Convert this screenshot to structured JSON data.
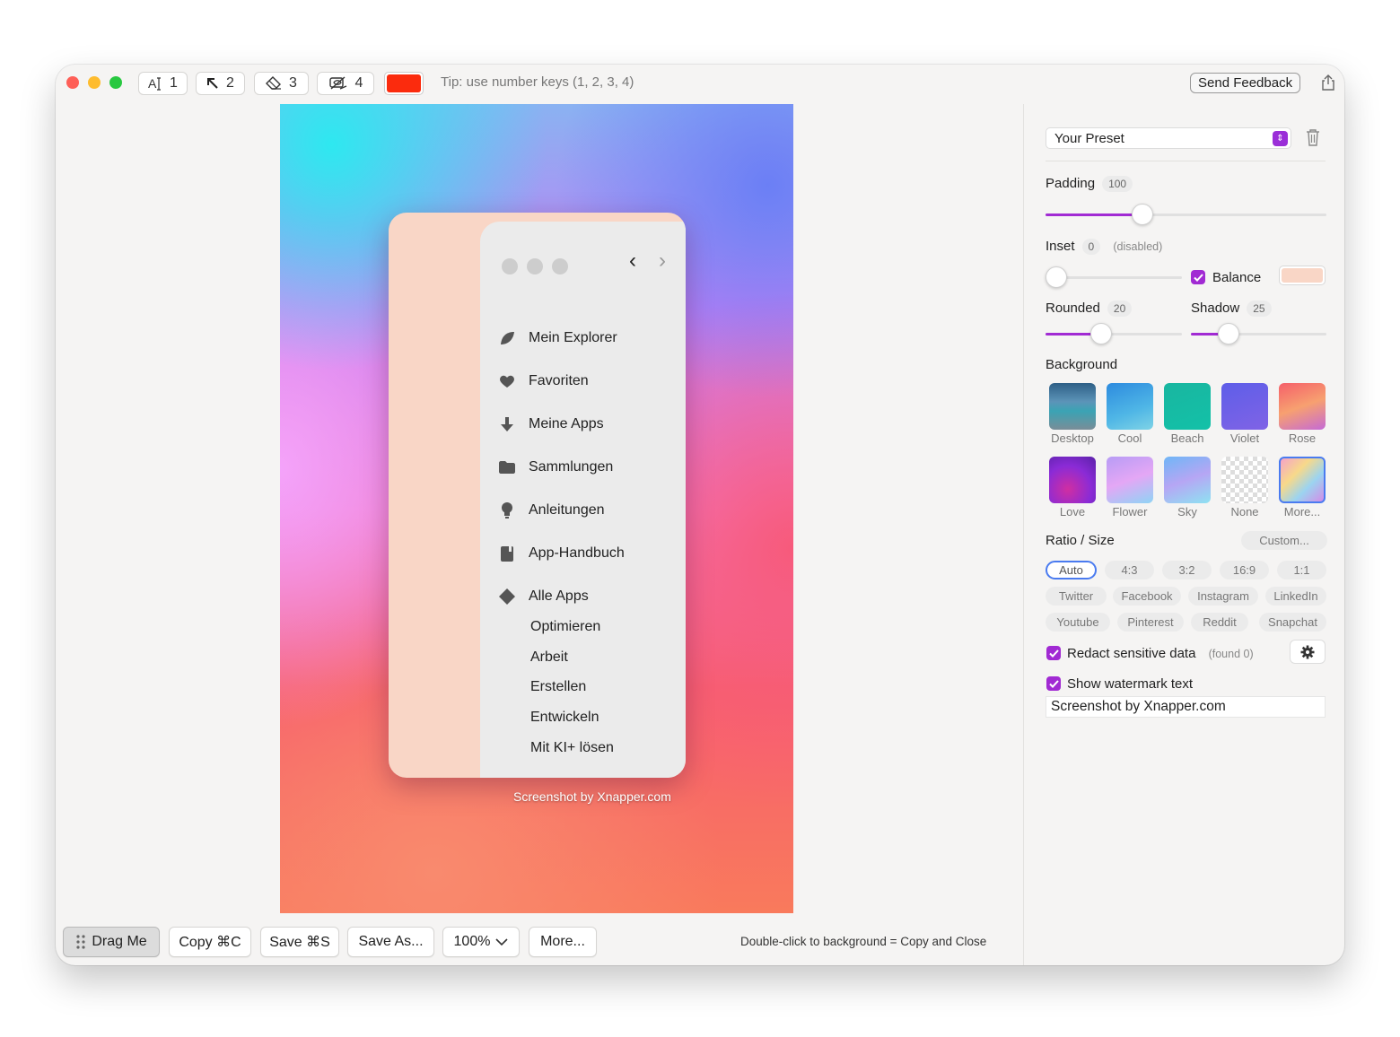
{
  "toolbar": {
    "text_tool": "1",
    "arrow_tool": "2",
    "eraser_tool": "3",
    "redact_tool": "4",
    "color": "#fb2b0d",
    "tip": "Tip: use number keys (1, 2, 3, 4)",
    "feedback": "Send Feedback"
  },
  "preview": {
    "menu_items": [
      {
        "label": "Mein Explorer",
        "icon": "leaf-icon"
      },
      {
        "label": "Favoriten",
        "icon": "heart-icon"
      },
      {
        "label": "Meine Apps",
        "icon": "download-arrow-icon"
      },
      {
        "label": "Sammlungen",
        "icon": "folder-icon"
      },
      {
        "label": "Anleitungen",
        "icon": "lightbulb-icon"
      },
      {
        "label": "App-Handbuch",
        "icon": "book-icon"
      },
      {
        "label": "Alle Apps",
        "icon": "diamond-icon"
      }
    ],
    "sub_items": [
      "Optimieren",
      "Arbeit",
      "Erstellen",
      "Entwickeln",
      "Mit KI+ lösen"
    ],
    "watermark": "Screenshot by Xnapper.com",
    "inner_background": "#f9d6c6"
  },
  "bottom": {
    "drag": "Drag Me",
    "copy": "Copy ⌘C",
    "save": "Save ⌘S",
    "save_as": "Save As...",
    "zoom": "100%",
    "more": "More...",
    "hint": "Double-click to background = Copy and Close"
  },
  "sidebar": {
    "preset": "Your Preset",
    "padding_label": "Padding",
    "padding_value": "100",
    "inset_label": "Inset",
    "inset_value": "0",
    "inset_note": "(disabled)",
    "balance_label": "Balance",
    "balance_checked": true,
    "balance_color": "#f9d6c6",
    "rounded_label": "Rounded",
    "rounded_value": "20",
    "shadow_label": "Shadow",
    "shadow_value": "25",
    "background_label": "Background",
    "backgrounds": [
      "Desktop",
      "Cool",
      "Beach",
      "Violet",
      "Rose",
      "Love",
      "Flower",
      "Sky",
      "None",
      "More..."
    ],
    "ratio_label": "Ratio / Size",
    "custom": "Custom...",
    "ratios": [
      "Auto",
      "4:3",
      "3:2",
      "16:9",
      "1:1"
    ],
    "selected_ratio": "Auto",
    "socials_row1": [
      "Twitter",
      "Facebook",
      "Instagram",
      "LinkedIn"
    ],
    "socials_row2": [
      "Youtube",
      "Pinterest",
      "Reddit",
      "Snapchat"
    ],
    "redact_label": "Redact sensitive data",
    "redact_found": "(found 0)",
    "redact_checked": true,
    "watermark_label": "Show watermark text",
    "watermark_checked": true,
    "watermark_text": "Screenshot by Xnapper.com",
    "accent": "#a12ad3"
  }
}
